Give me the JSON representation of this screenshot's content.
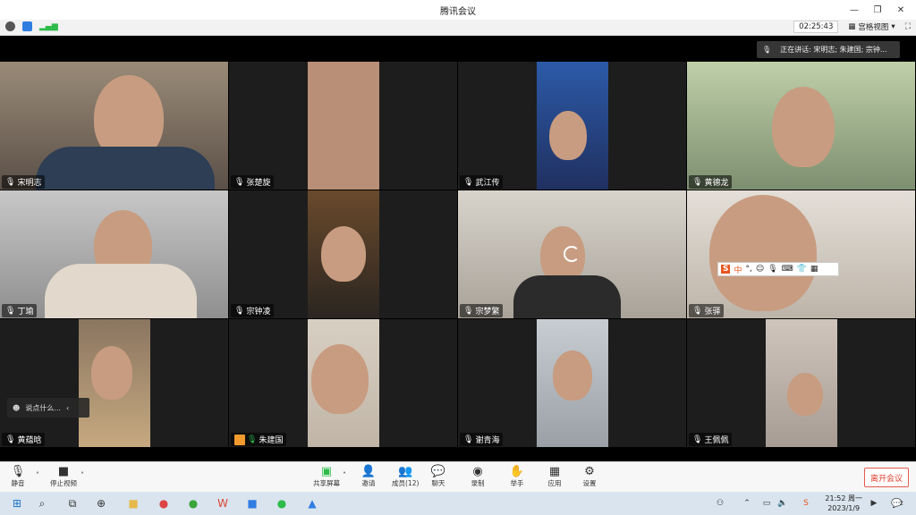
{
  "window": {
    "title": "腾讯会议"
  },
  "toolbar": {
    "timer": "02:25:43",
    "view_label": "宫格视图"
  },
  "speaking": {
    "text": "正在讲话: 宋明志; 朱建国; 宗钟..."
  },
  "participants": [
    {
      "name": "宋明志"
    },
    {
      "name": "张楚旋"
    },
    {
      "name": "武江传"
    },
    {
      "name": "黄德龙"
    },
    {
      "name": "丁瑜"
    },
    {
      "name": "宗钟凌"
    },
    {
      "name": "宗梦繁"
    },
    {
      "name": "张驿"
    },
    {
      "name": "黄蕴晗"
    },
    {
      "name": "朱建国"
    },
    {
      "name": "谢青海"
    },
    {
      "name": "王佩佩"
    }
  ],
  "chat": {
    "placeholder": "说点什么..."
  },
  "ime": {
    "label": "中"
  },
  "controls": {
    "mute": "静音",
    "stop_video": "停止视频",
    "share": "共享屏幕",
    "invite": "邀请",
    "members": "成员(12)",
    "chat": "聊天",
    "record": "录制",
    "raise_hand": "举手",
    "apps": "应用",
    "settings": "设置",
    "leave": "离开会议"
  },
  "taskbar": {
    "time": "21:52 周一",
    "date": "2023/1/9",
    "badge": "2"
  },
  "colors": {
    "active_border": "#2dbb4a",
    "leave": "#e03e2f"
  }
}
